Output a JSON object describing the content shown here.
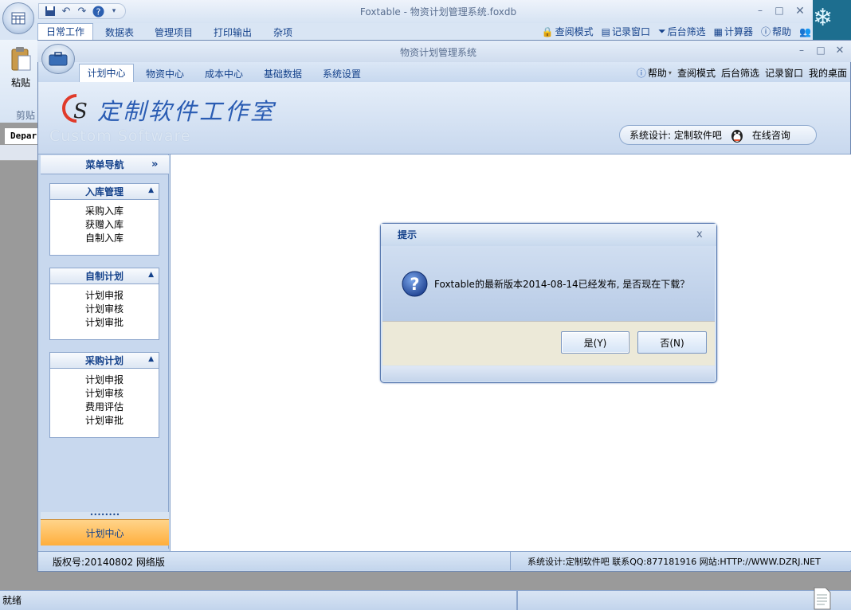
{
  "outer": {
    "title": "Foxtable - 物资计划管理系统.foxdb",
    "tabs": [
      "日常工作",
      "数据表",
      "管理项目",
      "打印输出",
      "杂项"
    ],
    "right_tools": [
      "查阅模式",
      "记录窗口",
      "后台筛选",
      "计算器",
      "帮助"
    ],
    "paste_label": "粘贴",
    "clipboard_label": "剪贴",
    "doc_tab": "Depar",
    "status": "就绪"
  },
  "inner": {
    "title": "物资计划管理系统",
    "tabs": [
      "计划中心",
      "物资中心",
      "成本中心",
      "基础数据",
      "系统设置"
    ],
    "right_tools": [
      "帮助",
      "查阅模式",
      "后台筛选",
      "记录窗口",
      "我的桌面"
    ],
    "logo_cn": "定制软件工作室",
    "logo_en": "Custom Software",
    "consult": {
      "designer": "系统设计: 定制软件吧",
      "online": "在线咨询"
    },
    "nav": {
      "title": "菜单导航",
      "arrows": "»",
      "groups": [
        {
          "title": "入库管理",
          "items": [
            "采购入库",
            "获赠入库",
            "自制入库"
          ]
        },
        {
          "title": "自制计划",
          "items": [
            "计划申报",
            "计划审核",
            "计划审批"
          ]
        },
        {
          "title": "采购计划",
          "items": [
            "计划申报",
            "计划审核",
            "费用评估",
            "计划审批"
          ]
        }
      ],
      "grip": "••••••••",
      "footer": "计划中心"
    },
    "status": {
      "left": "版权号:20140802  网络版",
      "right": "系统设计:定制软件吧   联系QQ:877181916   网站:HTTP://WWW.DZRJ.NET"
    }
  },
  "dialog": {
    "title": "提示",
    "close": "x",
    "message": "Foxtable的最新版本2014-08-14已经发布, 是否现在下载？",
    "yes": "是(Y)",
    "no": "否(N)"
  }
}
